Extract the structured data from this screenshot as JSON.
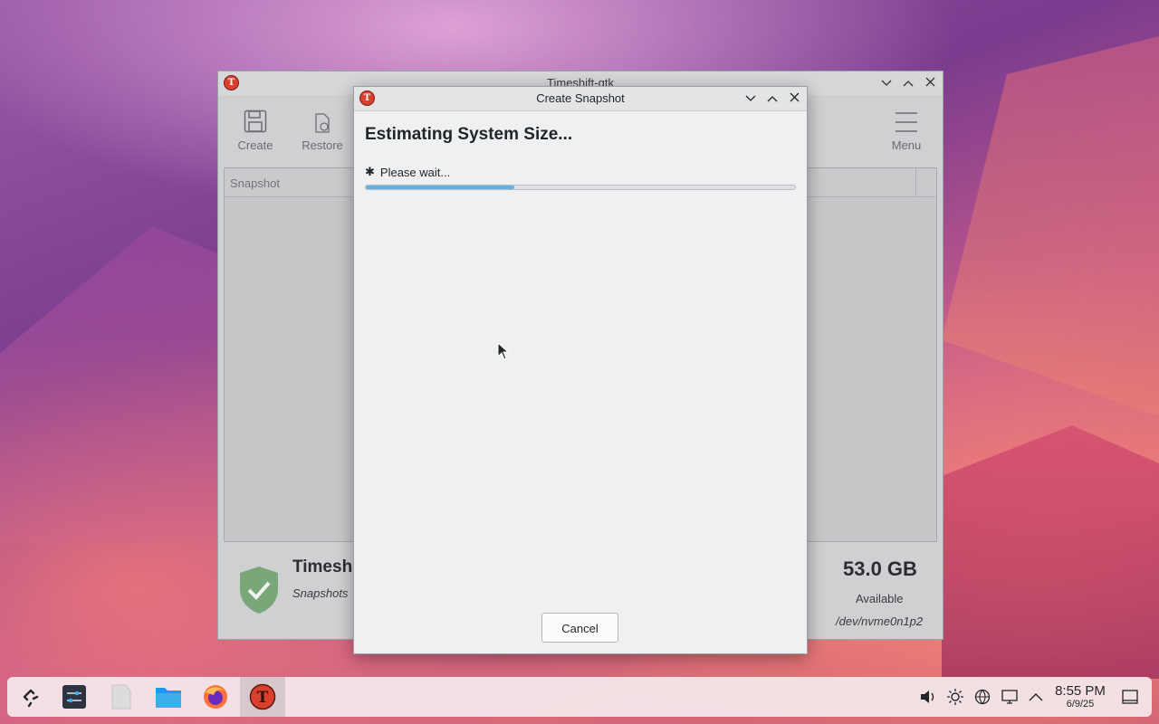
{
  "main_window": {
    "title": "Timeshift-gtk",
    "toolbar": {
      "create_label": "Create",
      "restore_label": "Restore",
      "menu_label": "Menu"
    },
    "list": {
      "column_snapshot": "Snapshot"
    },
    "status": {
      "title_partial": "Timesh",
      "subtitle_partial": "Snapshots",
      "size": "53.0 GB",
      "size_label": "Available",
      "device": "/dev/nvme0n1p2"
    }
  },
  "dialog": {
    "title": "Create Snapshot",
    "heading": "Estimating System Size...",
    "status_text": "Please wait...",
    "progress_fraction": 0.345,
    "cancel_label": "Cancel"
  },
  "taskbar": {
    "apps": [
      "app-launcher-icon",
      "system-settings-icon",
      "text-file-icon",
      "file-manager-icon",
      "firefox-icon",
      "timeshift-icon"
    ],
    "tray": [
      "volume-icon",
      "brightness-icon",
      "network-icon",
      "display-icon",
      "expand-tray-icon"
    ],
    "clock_time": "8:55 PM",
    "clock_date": "6/9/25"
  },
  "colors": {
    "accent": "#5eb3e6",
    "timeshift_red": "#d9412e",
    "shield_green": "#7aa77a"
  }
}
